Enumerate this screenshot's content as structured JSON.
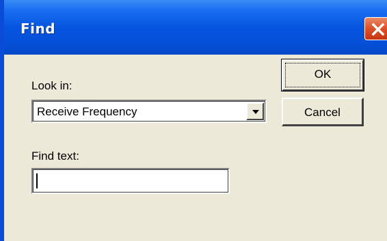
{
  "window": {
    "title": "Find",
    "title_bar_color": "#0654e0",
    "close_button_color": "#e0542a"
  },
  "form": {
    "look_in_label": "Look in:",
    "look_in_value": "Receive Frequency",
    "find_text_label": "Find text:",
    "find_text_value": ""
  },
  "buttons": {
    "ok_label": "OK",
    "cancel_label": "Cancel"
  },
  "icons": {
    "close": "close-icon",
    "dropdown": "chevron-down-icon"
  }
}
